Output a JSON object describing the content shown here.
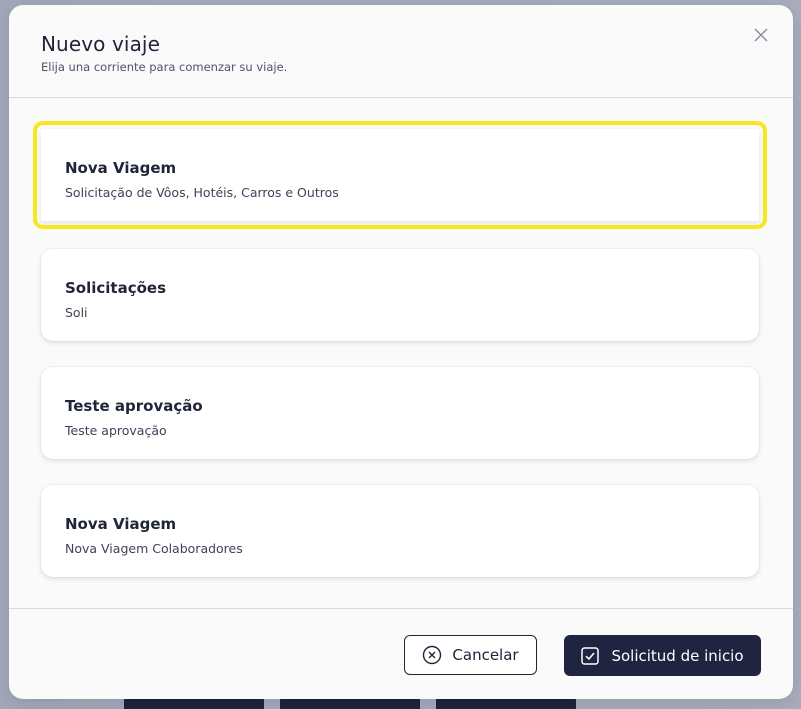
{
  "modal": {
    "title": "Nuevo viaje",
    "subtitle": "Elija una corriente para comenzar su viaje.",
    "close_icon": "close-icon"
  },
  "options": [
    {
      "title": "Nova Viagem",
      "description": "Solicitação de Vôos, Hotéis, Carros e Outros",
      "selected": true
    },
    {
      "title": "Solicitações",
      "description": "Soli",
      "selected": false
    },
    {
      "title": "Teste aprovação",
      "description": "Teste aprovação",
      "selected": false
    },
    {
      "title": "Nova Viagem",
      "description": "Nova Viagem Colaboradores",
      "selected": false
    }
  ],
  "footer": {
    "cancel_label": "Cancelar",
    "start_label": "Solicitud de inicio"
  },
  "colors": {
    "primary": "#1f2540",
    "highlight": "#f8e71c",
    "backdrop": "#a4a9ba"
  }
}
